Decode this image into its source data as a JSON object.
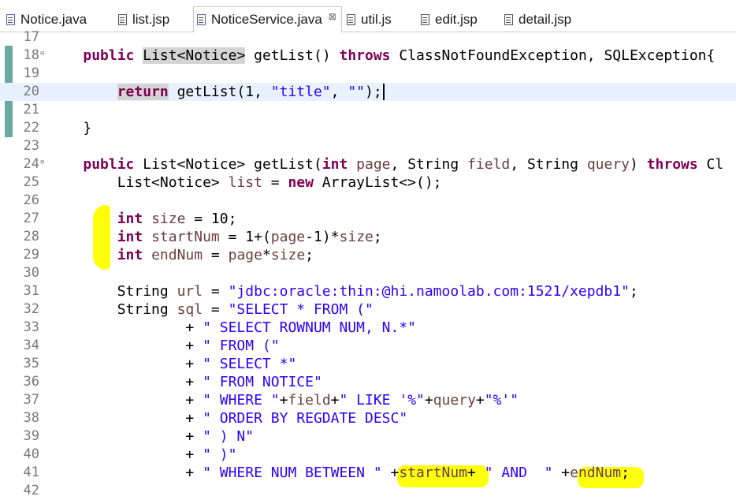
{
  "tabs": [
    {
      "label": "Notice.java",
      "icon": "java-file-icon",
      "active": false
    },
    {
      "label": "list.jsp",
      "icon": "jsp-file-icon",
      "active": false
    },
    {
      "label": "NoticeService.java",
      "icon": "java-file-icon",
      "active": true,
      "close": "⊠"
    },
    {
      "label": "util.js",
      "icon": "js-file-icon",
      "active": false
    },
    {
      "label": "edit.jsp",
      "icon": "jsp-file-icon",
      "active": false
    },
    {
      "label": "detail.jsp",
      "icon": "jsp-file-icon",
      "active": false
    }
  ],
  "editor": {
    "current_line": "20",
    "lines": [
      {
        "n": "17",
        "t": ""
      },
      {
        "n": "18",
        "t": "    public List<Notice> getList() throws ClassNotFoundException, SQLException{"
      },
      {
        "n": "19",
        "t": ""
      },
      {
        "n": "20",
        "t": "        return getList(1, \"title\", \"\");"
      },
      {
        "n": "21",
        "t": ""
      },
      {
        "n": "22",
        "t": "    }"
      },
      {
        "n": "23",
        "t": ""
      },
      {
        "n": "24",
        "t": "    public List<Notice> getList(int page, String field, String query) throws Cl"
      },
      {
        "n": "25",
        "t": "        List<Notice> list = new ArrayList<>();"
      },
      {
        "n": "26",
        "t": ""
      },
      {
        "n": "27",
        "t": "        int size = 10;"
      },
      {
        "n": "28",
        "t": "        int startNum = 1+(page-1)*size;"
      },
      {
        "n": "29",
        "t": "        int endNum = page*size;"
      },
      {
        "n": "30",
        "t": ""
      },
      {
        "n": "31",
        "t": "        String url = \"jdbc:oracle:thin:@hi.namoolab.com:1521/xepdb1\";"
      },
      {
        "n": "32",
        "t": "        String sql = \"SELECT * FROM (\""
      },
      {
        "n": "33",
        "t": "                + \" SELECT ROWNUM NUM, N.*\""
      },
      {
        "n": "34",
        "t": "                + \" FROM (\""
      },
      {
        "n": "35",
        "t": "                + \" SELECT *\""
      },
      {
        "n": "36",
        "t": "                + \" FROM NOTICE\""
      },
      {
        "n": "37",
        "t": "                + \" WHERE \"+field+\" LIKE '%\"+query+\"%'\""
      },
      {
        "n": "38",
        "t": "                + \" ORDER BY REGDATE DESC\""
      },
      {
        "n": "39",
        "t": "                + \" ) N\""
      },
      {
        "n": "40",
        "t": "                + \" )\""
      },
      {
        "n": "41",
        "t": "                + \" WHERE NUM BETWEEN \" +startNum+ \" AND  \" +endNum;"
      },
      {
        "n": "42",
        "t": ""
      }
    ]
  },
  "colors": {
    "keyword": "#7f0055",
    "string": "#2a00ff",
    "variable": "#6a3e3e",
    "current_line_bg": "#e8f2fe",
    "highlight": "#ffff00"
  }
}
